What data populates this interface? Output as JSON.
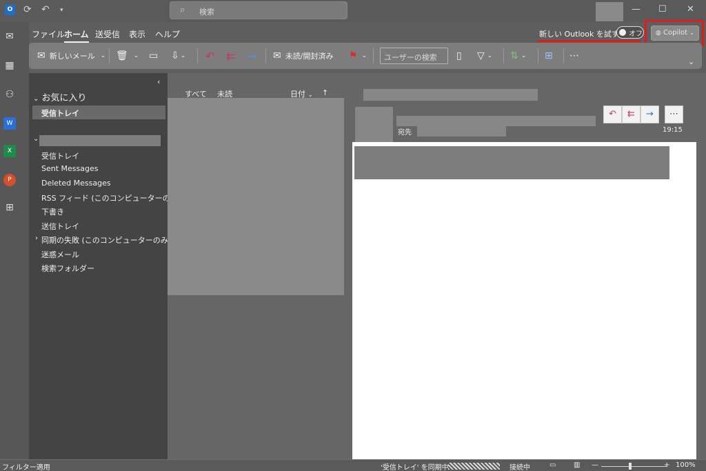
{
  "titlebar": {
    "search_placeholder": "検索",
    "icons": [
      "outlook-logo-icon",
      "sync-icon",
      "undo-icon",
      "quick-access-dropdown-icon"
    ],
    "window_buttons": {
      "minimize": "—",
      "maximize": "☐",
      "close": "✕"
    }
  },
  "menu": {
    "tabs": [
      "ファイル",
      "ホーム",
      "送受信",
      "表示",
      "ヘルプ"
    ],
    "active_tab": "ホーム"
  },
  "new_outlook": {
    "label": "新しい Outlook を試す",
    "toggle_state": "オフ"
  },
  "copilot": {
    "label": "Copilot"
  },
  "ribbon": {
    "new_mail": "新しいメール",
    "read_unread": "未読/開封済み",
    "user_search_placeholder": "ユーザーの検索"
  },
  "folders": {
    "favorites_title": "お気に入り",
    "favorite_items": [
      "受信トレイ"
    ],
    "account_items": [
      "受信トレイ",
      "Sent Messages",
      "Deleted Messages",
      "RSS フィード (このコンピューターのみ)",
      "下書き",
      "送信トレイ",
      "同期の失敗 (このコンピューターのみ)",
      "迷惑メール",
      "検索フォルダー"
    ]
  },
  "message_list": {
    "filter_all": "すべて",
    "filter_unread": "未読",
    "sort_label": "日付",
    "sort_arrow": "↑"
  },
  "reading_pane": {
    "to_label": "宛先",
    "time": "19:15"
  },
  "statusbar": {
    "left": "フィルター適用",
    "sync_text": "'受信トレイ' を同期中",
    "connection": "接続中",
    "zoom": "100%",
    "zoom_minus": "—",
    "zoom_plus": "+"
  },
  "colors": {
    "highlight": "#e01b1b",
    "reply_icon": "#c0396b",
    "forward_icon": "#2f6fd6",
    "flag": "#d23030"
  }
}
